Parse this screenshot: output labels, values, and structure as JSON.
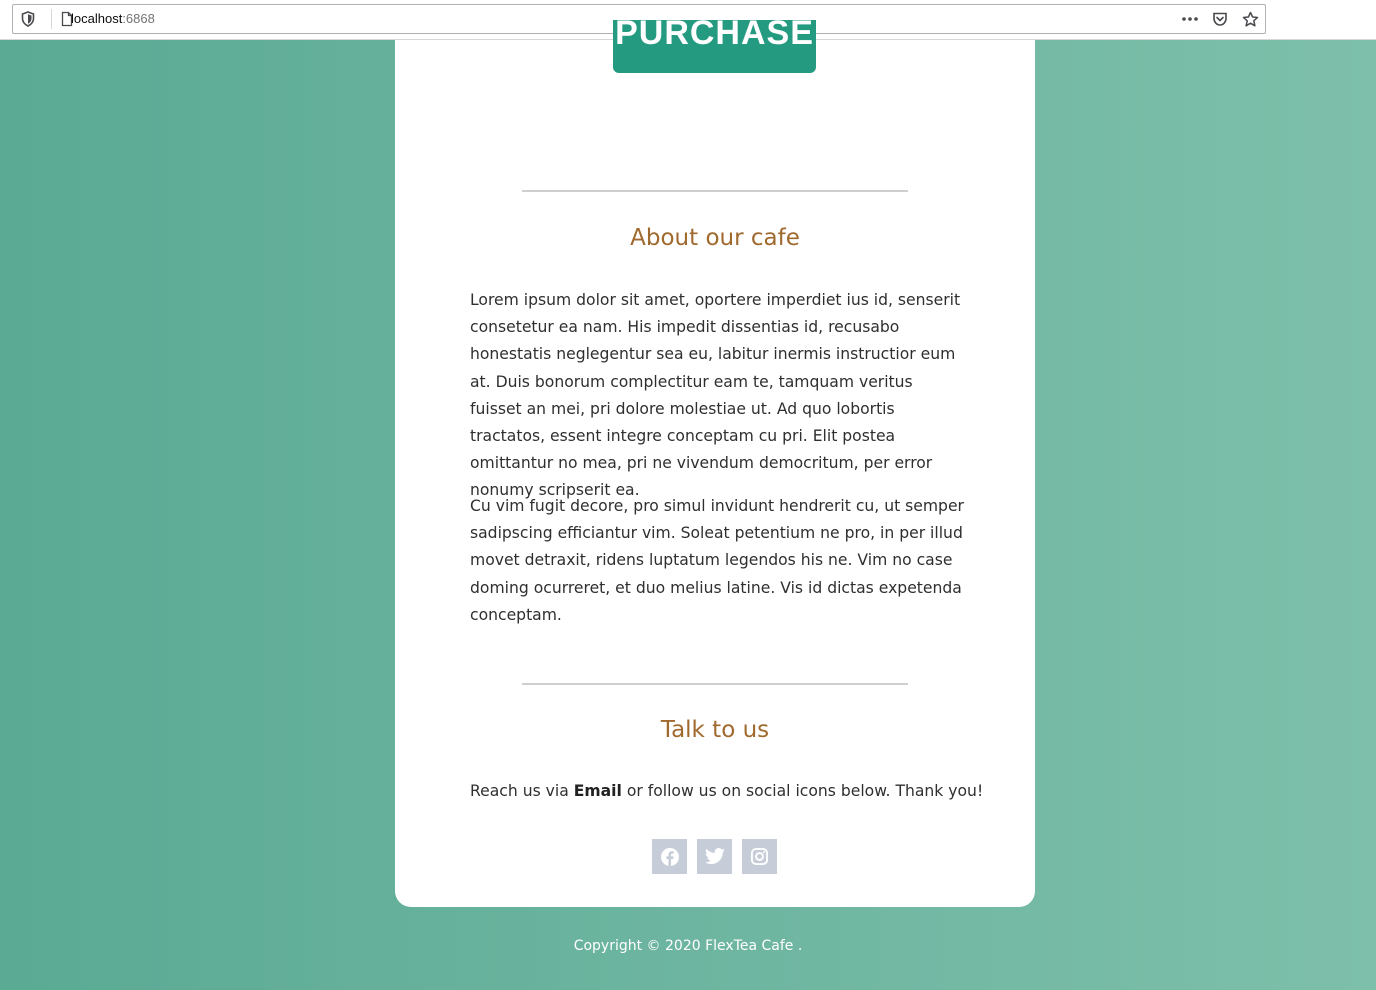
{
  "browser": {
    "url_host": "localhost",
    "url_port": ":6868",
    "icons": [
      "shield-icon",
      "page-icon",
      "more-icon",
      "pocket-icon",
      "bookmark-star-icon"
    ]
  },
  "card": {
    "purchase_label": "PURCHASE",
    "about": {
      "title": "About our cafe",
      "paragraphs": [
        "Lorem ipsum dolor sit amet, oportere imperdiet ius id, senserit consetetur ea nam. His impedit dissentias id, recusabo honestatis neglegentur sea eu, labitur inermis instructior eum at. Duis bonorum complectitur eam te, tamquam veritus fuisset an mei, pri dolore molestiae ut. Ad quo lobortis tractatos, essent integre conceptam cu pri. Elit postea omittantur no mea, pri ne vivendum democritum, per error nonumy scripserit ea.",
        "Cu vim fugit decore, pro simul invidunt hendrerit cu, ut semper sadipscing efficiantur vim. Soleat petentium ne pro, in per illud movet detraxit, ridens luptatum legendos his ne. Vim no case doming ocurreret, et duo melius latine. Vis id dictas expetenda conceptam."
      ]
    },
    "contact": {
      "title": "Talk to us",
      "text_before": "Reach us via ",
      "email_label": "Email",
      "text_after": " or follow us on social icons below. Thank you!"
    },
    "socials": [
      "facebook-icon",
      "twitter-icon",
      "instagram-icon"
    ]
  },
  "footer": {
    "copyright": "Copyright © 2020 FlexTea Cafe ."
  },
  "colors": {
    "accent": "#249a80",
    "heading": "#a0692e",
    "social_bg": "#c6cdd9"
  }
}
